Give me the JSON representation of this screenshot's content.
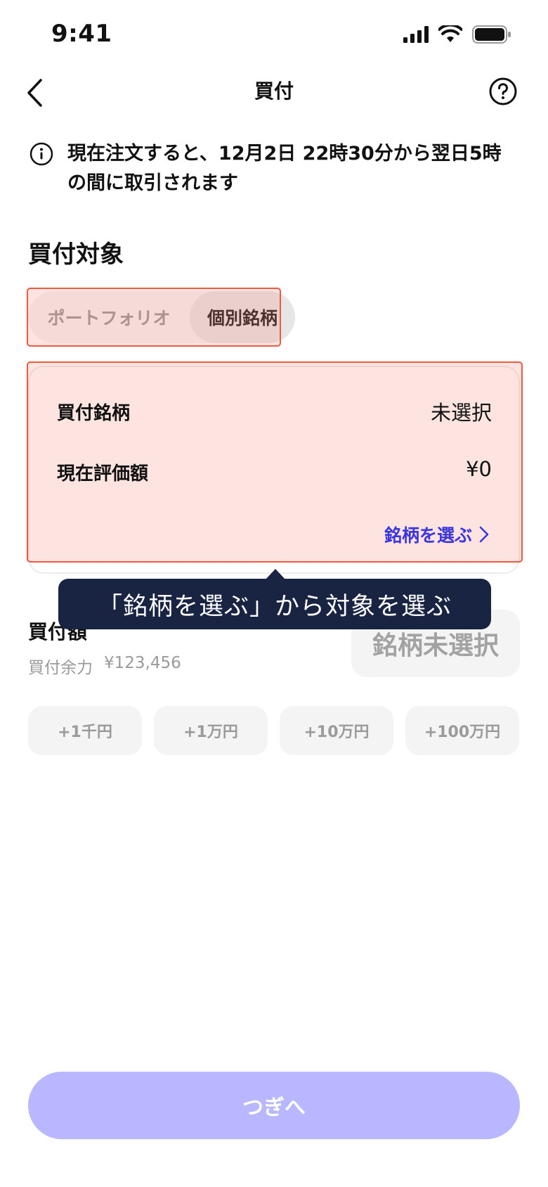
{
  "status_bar": {
    "time": "9:41"
  },
  "header": {
    "title": "買付"
  },
  "notice": {
    "text": "現在注文すると、12月2日 22時30分から翌日5時の間に取引されます"
  },
  "target_section": {
    "title": "買付対象",
    "segments": [
      "ポートフォリオ",
      "個別銘柄"
    ],
    "selected": "個別銘柄"
  },
  "card": {
    "rows": [
      {
        "label": "買付銘柄",
        "value": "未選択"
      },
      {
        "label": "現在評価額",
        "value": "¥0"
      }
    ],
    "select_link": "銘柄を選ぶ"
  },
  "tooltip": {
    "text": "「銘柄を選ぶ」から対象を選ぶ"
  },
  "amount": {
    "label": "買付額",
    "buying_power_label": "買付余力",
    "buying_power_value": "¥123,456",
    "display": "銘柄未選択"
  },
  "quick_add": [
    "+1千円",
    "+1万円",
    "+10万円",
    "+100万円"
  ],
  "footer": {
    "next_label": "つぎへ"
  },
  "colors": {
    "accent": "#3a35dd",
    "next_button_disabled": "#b8b7ff",
    "tooltip_bg": "#192342",
    "highlight": "#ee5a40"
  }
}
